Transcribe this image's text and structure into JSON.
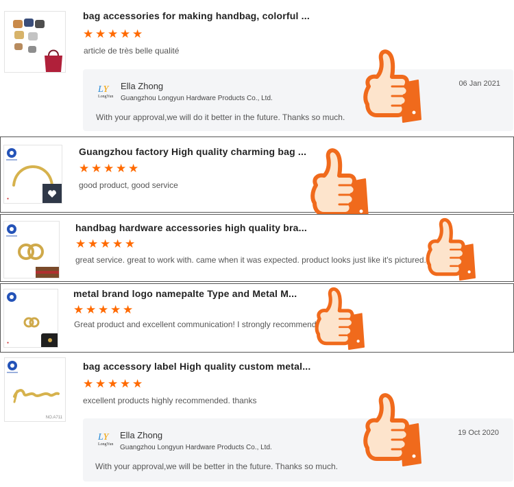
{
  "reviews": [
    {
      "title": "bag accessories for making handbag, colorful ...",
      "rating": 5,
      "text": "article de très belle qualité",
      "reply": {
        "name": "Ella Zhong",
        "company": "Guangzhou Longyun Hardware Products Co., Ltd.",
        "date": "06 Jan 2021",
        "message": "With your approval,we will do it better in the future. Thanks so much.",
        "logo_mark": "LY",
        "logo_text": "LongYun"
      }
    },
    {
      "title": "Guangzhou factory High quality charming bag ...",
      "rating": 5,
      "text": "good product, good service"
    },
    {
      "title": "handbag hardware accessories high quality bra...",
      "rating": 5,
      "text": "great service. great to work with. came when it was expected. product looks just like it's pictured."
    },
    {
      "title": "metal brand logo namepalte Type and Metal M...",
      "rating": 5,
      "text": "Great product and excellent communication! I strongly recommend."
    },
    {
      "title": "bag accessory label High quality custom metal...",
      "rating": 5,
      "text": "excellent products highly recommended. thanks",
      "thumb_code": "NO.A711",
      "reply": {
        "name": "Ella Zhong",
        "company": "Guangzhou Longyun Hardware Products Co., Ltd.",
        "date": "19 Oct 2020",
        "message": "With your approval,we will be better in the future. Thanks so much.",
        "logo_mark": "LY",
        "logo_text": "LongYun"
      }
    }
  ],
  "icons": {
    "star": "star-icon",
    "thumbs_up": "thumbs-up-icon",
    "star_color": "#ff6a00",
    "thumb_fill": "#fde4cc",
    "thumb_stroke": "#f06a1c"
  }
}
